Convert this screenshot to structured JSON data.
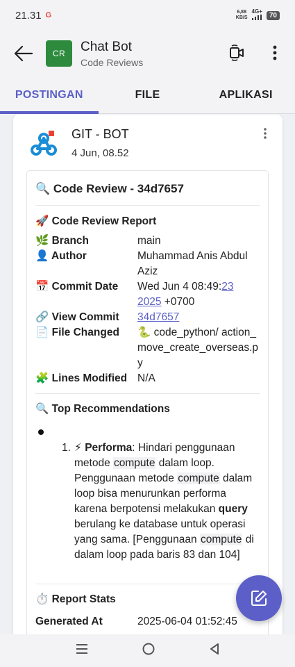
{
  "status": {
    "time": "21.31",
    "net_speed_top": "6,88",
    "net_speed_bottom": "KB/S",
    "network": "4G+",
    "battery": "70"
  },
  "header": {
    "avatar_text": "CR",
    "title": "Chat Bot",
    "subtitle": "Code Reviews"
  },
  "tabs": [
    {
      "label": "POSTINGAN"
    },
    {
      "label": "FILE"
    },
    {
      "label": "APLIKASI"
    }
  ],
  "post": {
    "author": "GIT - BOT",
    "date": "4 Jun, 08.52",
    "review_title": "🔍 Code Review - 34d7657",
    "report_title": "🚀 Code Review Report",
    "fields": [
      {
        "key": "🌿 Branch",
        "value": "main"
      },
      {
        "key": "👤 Author",
        "value": "Muhammad Anis Abdul Aziz"
      },
      {
        "key": "📅 Commit Date",
        "value_a": "Wed Jun 4 08:49:",
        "value_link": "23 2025",
        "value_b": " +0700"
      },
      {
        "key": "🔗 View Commit",
        "value": "34d7657"
      },
      {
        "key": "📄 File Changed",
        "value": "🐍 code_python/ action_move_create_overseas.py"
      },
      {
        "key": "🧩 Lines Modified",
        "value": "N/A"
      }
    ],
    "recommendations_title": "🔍 Top Recommendations",
    "reco_num": "1.",
    "reco_icon": "⚡",
    "reco_bold": "Performa",
    "reco_p1": ": Hindari penggunaan metode ",
    "reco_code1": "compute",
    "reco_p2": " dalam loop. Penggunaan metode ",
    "reco_code2": "compute",
    "reco_p3": " dalam loop bisa menurunkan performa karena berpotensi melakukan ",
    "reco_bold2": "query",
    "reco_p4": " berulang ke database untuk operasi yang sama. [Penggunaan ",
    "reco_code3": "compute",
    "reco_p5": " di dalam loop pada baris 83 dan 104]",
    "stats_title": "⏱️ Report Stats",
    "generated_key": "Generated At",
    "generated_value": "2025-06-04 01:52:45"
  },
  "colors": {
    "accent": "#5b5fc7",
    "avatar": "#2e8b3e"
  }
}
